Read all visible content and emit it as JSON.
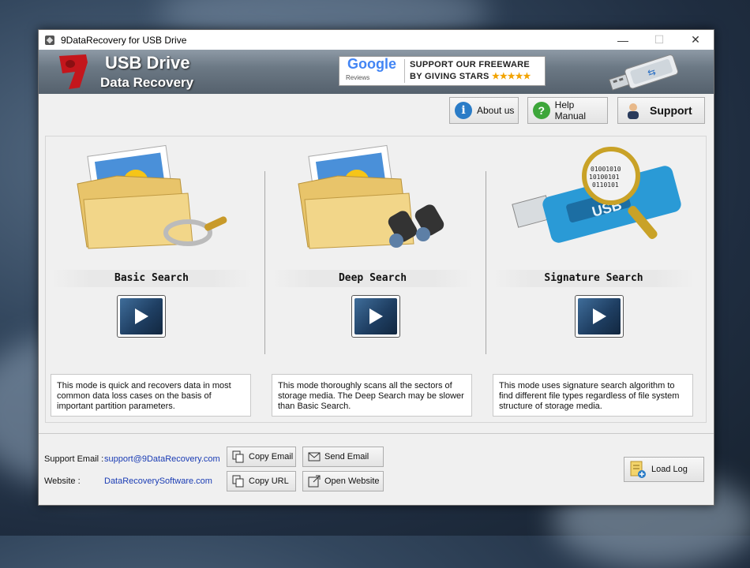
{
  "window": {
    "title": "9DataRecovery for USB Drive"
  },
  "window_controls": {
    "minimize": "—",
    "maximize": "☐",
    "close": "✕"
  },
  "banner": {
    "line1": "USB Drive",
    "line2": "Data Recovery",
    "google_word": "Google",
    "google_sub": "Reviews",
    "promo_line1": "SUPPORT OUR FREEWARE",
    "promo_line2": "BY GIVING STARS",
    "stars": "★★★★★"
  },
  "toolbar": {
    "about_label": "About us",
    "help_label": "Help Manual",
    "support_label": "Support"
  },
  "modes": [
    {
      "label": "Basic Search",
      "description": "This mode is quick and recovers data in most common data loss cases on the basis of important partition parameters."
    },
    {
      "label": "Deep Search",
      "description": "This mode thoroughly scans all the sectors of storage media. The Deep Search may be slower than Basic Search."
    },
    {
      "label": "Signature Search",
      "description": "This mode uses signature search algorithm to find different file types regardless of file system structure of storage media."
    }
  ],
  "footer": {
    "email_label": "Support Email :",
    "email_value": "support@9DataRecovery.com",
    "website_label": "Website :",
    "website_value": "DataRecoverySoftware.com",
    "copy_email": "Copy Email",
    "send_email": "Send Email",
    "copy_url": "Copy URL",
    "open_website": "Open Website",
    "load_log": "Load Log"
  },
  "icons": {
    "about": "info-icon",
    "help": "question-icon",
    "support": "person-icon",
    "play": "play-icon"
  },
  "colors": {
    "link": "#1a3cb4",
    "accent_red": "#c4161c"
  }
}
